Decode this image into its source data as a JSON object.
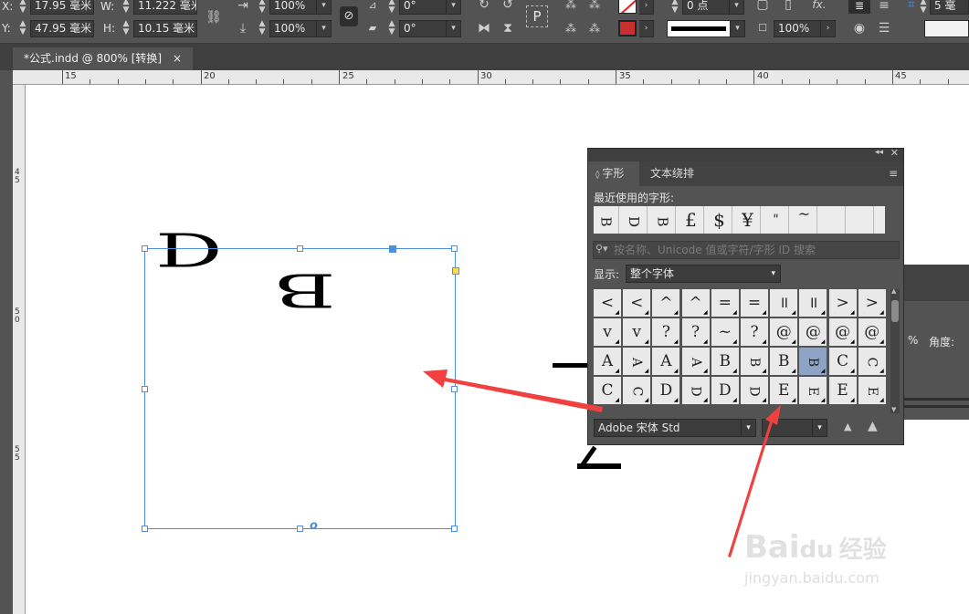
{
  "control_bar": {
    "x_label": "X:",
    "x_value": "17.95 毫米",
    "y_label": "Y:",
    "y_value": "47.95 毫米",
    "w_label": "W:",
    "w_value": "11.222 毫米",
    "h_label": "H:",
    "h_value": "10.15 毫米",
    "scale_x": "100%",
    "scale_y": "100%",
    "rotate": "0°",
    "shear": "0°",
    "stroke_weight": "0 点",
    "opacity": "100%",
    "corner_value": "5 毫",
    "p_icon": "P"
  },
  "document_tab": {
    "title": "*公式.indd @ 800% [转换]",
    "close": "×"
  },
  "ruler": {
    "labels": [
      "15",
      "20",
      "25",
      "30",
      "35",
      "40",
      "45"
    ]
  },
  "vruler": {
    "labels": [
      "4\n5",
      "5\n0",
      "5\n5"
    ]
  },
  "canvas": {
    "glyph_d": "D",
    "glyph_b": "B",
    "frame_anchor": "o"
  },
  "glyph_panel": {
    "tabs": [
      "字形",
      "文本绕排"
    ],
    "recent_label": "最近使用的字形:",
    "recent_glyphs": [
      "B",
      "D",
      "B",
      "£",
      "$",
      "¥",
      "\"",
      "~",
      "",
      ""
    ],
    "search_placeholder": "按名称、Unicode 值或字符/字形 ID 搜索",
    "show_label": "显示:",
    "show_value": "整个字体",
    "grid": [
      [
        "<",
        "<",
        "^",
        "^",
        "=",
        "=",
        "॥",
        "॥",
        ">",
        ">"
      ],
      [
        "v",
        "v",
        "?",
        "?",
        "~",
        "?",
        "@",
        "@",
        "@",
        "@"
      ],
      [
        "A",
        "A",
        "A",
        "A",
        "B",
        "B",
        "B",
        "B",
        "C",
        "C"
      ],
      [
        "C",
        "C",
        "D",
        "D",
        "D",
        "D",
        "E",
        "E",
        "E",
        "E"
      ]
    ],
    "font_name": "Adobe 宋体 Std",
    "font_style": ""
  },
  "side_panel": {
    "percent": "%",
    "angle_label": "角度:"
  },
  "watermark": {
    "brand": "Bai",
    "brand2": "du",
    "brand_cn": "经验",
    "url": "jingyan.baidu.com"
  },
  "colors": {
    "accent": "#4d8fe0",
    "arrow": "#f04040",
    "selected_cell": "#8ea4c6"
  }
}
